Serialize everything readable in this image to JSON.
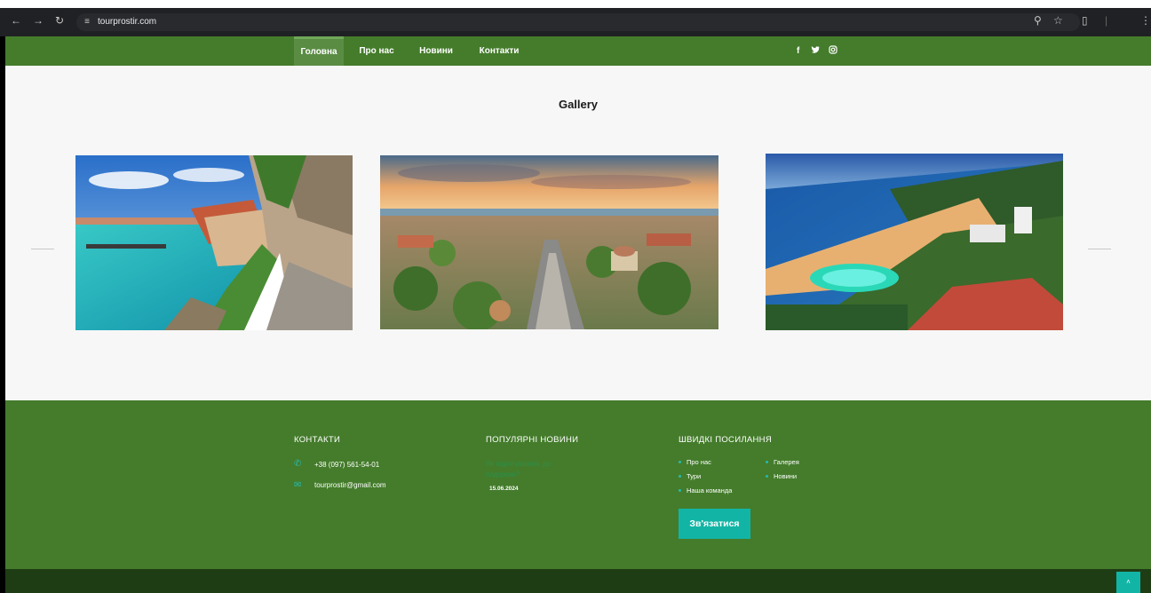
{
  "browser": {
    "url": "tourprostir.com",
    "icons": [
      "back-icon",
      "forward-icon",
      "reload-icon",
      "site-settings-icon",
      "zoom-icon",
      "bookmark-star-icon",
      "extensions-icon"
    ]
  },
  "nav": {
    "items": [
      {
        "label": "Головна"
      },
      {
        "label": "Про нас"
      },
      {
        "label": "Новини"
      },
      {
        "label": "Контакти"
      }
    ],
    "social": [
      "f",
      "🐦",
      "◎"
    ]
  },
  "gallery": {
    "title": "Gallery",
    "prev_arrow": "←",
    "next_arrow": "→"
  },
  "footer": {
    "contacts": {
      "title": "КОНТАКТИ",
      "phone": "+38 (097) 561-54-01",
      "email": "tourprostir@gmail.com"
    },
    "news": {
      "title": "ПОПУЛЯРНІ НОВИНИ",
      "item_title": "Як підготуватись до подорожі?",
      "item_date": "15.06.2024"
    },
    "quick_links": {
      "title": "ШВИДКІ ПОСИЛАННЯ",
      "col1": [
        "Про нас",
        "Тури",
        "Наша команда"
      ],
      "col2": [
        "Галерея",
        "Новини"
      ]
    },
    "contact_button": "Зв'язатися",
    "to_top": "˄"
  },
  "colors": {
    "nav_green": "#447c2b",
    "accent_teal": "#12b5a5",
    "footer_dark": "#1f3d14"
  }
}
